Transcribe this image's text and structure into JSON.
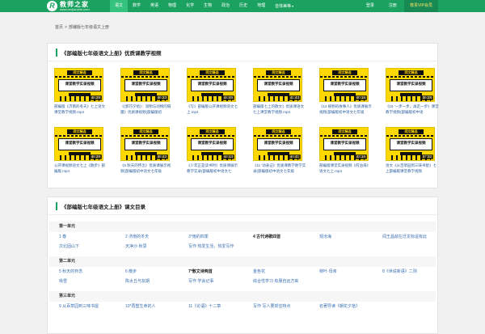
{
  "header": {
    "logo_mark": "R",
    "logo_text": "教师之家",
    "logo_url": "www.renjiaoshe.com",
    "nav": [
      {
        "label": "语文",
        "active": true
      },
      {
        "label": "数学"
      },
      {
        "label": "英语"
      },
      {
        "label": "物理"
      },
      {
        "label": "化学"
      },
      {
        "label": "生物"
      },
      {
        "label": "政治"
      },
      {
        "label": "历史"
      },
      {
        "label": "地理"
      },
      {
        "label": "音体美等"
      }
    ],
    "login": "登录",
    "register": "注册",
    "vip": "尊贵VIP会员"
  },
  "breadcrumb": {
    "home": "首页",
    "sep": ">",
    "current": "部编版七年级语文上册"
  },
  "videos_panel": {
    "title": "《部编版七年级语文上册》优质课教学视频",
    "thumb_tag": "同文精选",
    "thumb_board": "课堂教学实录视频",
    "items": [
      {
        "duration": "46:28",
        "title": "部编版《济南的冬天》七上语文课堂教学视频.mp4"
      },
      {
        "duration": "46:23",
        "title": "《(郭巧夕拾》：润物与动物的隔膜》优质课视频(部编版初"
      },
      {
        "duration": "44:45",
        "title": "《写》部编版公开课视频语文七上.mp4"
      },
      {
        "duration": "41:43",
        "title": "部编版七上的散文》优质课语文七上课堂教学视频.mp4"
      },
      {
        "duration": "40:16",
        "title": "《14 植物的故事人》优质课展示视频(部编版初中语文七年级"
      },
      {
        "duration": "36:28",
        "title": "《15 '一步一步，再走一步》课堂教学视频(部编版初中语"
      },
      {
        "duration": "46:28",
        "title": "公开课视频语文七上《散步》部编版.mp4"
      },
      {
        "duration": "45:42",
        "title": "《5 秋天的怀念》优质课展示视频(部编版初中语文七年级"
      },
      {
        "duration": "44:13",
        "title": "《少年正是读书时》优质课展示教学实录(部编版初中语文七"
      },
      {
        "duration": "44:41",
        "title": "《11 '动表记》优质课教学教学实录(部编版初中语文七年级"
      },
      {
        "duration": "43:16",
        "title": "部编版课堂实录视频《何泊海》语文七上.mp4"
      },
      {
        "duration": "37:32",
        "title": "语文《从百草园到三味书屋》七上部编版课堂教学视频"
      }
    ]
  },
  "toc_panel": {
    "title": "《部编版七年级语文上册》课文目录",
    "units": [
      {
        "name": "第一单元",
        "rows": [
          [
            {
              "t": "1 春"
            },
            {
              "t": "2 济南的冬天"
            },
            {
              "t": "3*雨的四季"
            },
            {
              "t": "4 古代诗歌四首",
              "b": true
            },
            {
              "t": "观沧海"
            },
            {
              "t": "闻王昌龄左迁龙标遥有此"
            }
          ],
          [
            {
              "t": "次北固山下"
            },
            {
              "t": "天净沙·秋思"
            },
            {
              "t": "写作 热爱生活，热爱写作"
            }
          ]
        ]
      },
      {
        "name": "第二单元",
        "rows": [
          [
            {
              "t": "5 秋天的怀念"
            },
            {
              "t": "6 散步"
            },
            {
              "t": "7*散文诗两首",
              "b": true
            },
            {
              "t": "金色花"
            },
            {
              "t": "荷叶·母亲"
            },
            {
              "t": "8《世说新语》二则"
            }
          ],
          [
            {
              "t": "咏雪"
            },
            {
              "t": "陈太丘与友期"
            },
            {
              "t": "写作 学会记事"
            },
            {
              "t": "综合性学习 有朋自远方来"
            }
          ]
        ]
      },
      {
        "name": "第三单元",
        "rows": [
          [
            {
              "t": "9 从百草园到三味书屋"
            },
            {
              "t": "10*再塑生命的人"
            },
            {
              "t": "11《论语》十二章"
            },
            {
              "t": "写作 写人要抓住特点"
            },
            {
              "t": "名著导读《朝花夕拾》"
            }
          ]
        ]
      }
    ]
  }
}
